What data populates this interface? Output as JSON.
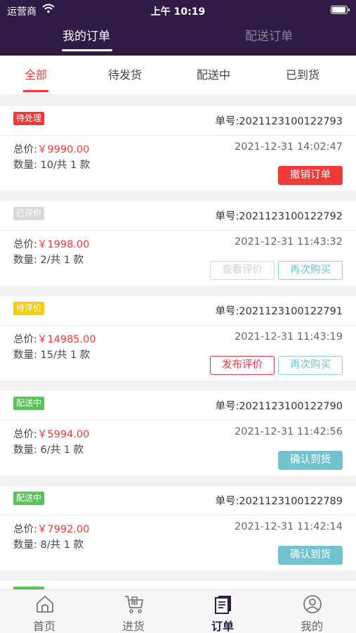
{
  "status_bar": {
    "carrier": "运营商",
    "time": "上午 10:19"
  },
  "top_tabs": [
    {
      "label": "我的订单",
      "active": true
    },
    {
      "label": "配送订单",
      "active": false
    }
  ],
  "sub_tabs": [
    {
      "label": "全部",
      "active": true
    },
    {
      "label": "待发货",
      "active": false
    },
    {
      "label": "配送中",
      "active": false
    },
    {
      "label": "已到货",
      "active": false
    }
  ],
  "orders": [
    {
      "status": "待处理",
      "status_color": "#f03a3a",
      "order_no": "单号:2021123100122793",
      "price_label": "总价:",
      "price": "￥9990.00",
      "date": "2021-12-31 14:02:47",
      "qty": "数量: 10/共 1 款",
      "buttons": [
        "撤销订单"
      ]
    },
    {
      "status": "已评价",
      "status_color": "#d9d9d9",
      "order_no": "单号:2021123100122792",
      "price_label": "总价:",
      "price": "￥1998.00",
      "date": "2021-12-31 11:43:32",
      "qty": "数量: 2/共 1 款",
      "buttons": [
        "查看评价",
        "再次购买"
      ]
    },
    {
      "status": "待评价",
      "status_color": "#f5cd00",
      "order_no": "单号:2021123100122791",
      "price_label": "总价:",
      "price": "￥14985.00",
      "date": "2021-12-31 11:43:19",
      "qty": "数量: 15/共 1 款",
      "buttons": [
        "发布评价",
        "再次购买"
      ]
    },
    {
      "status": "配送中",
      "status_color": "#5cc15a",
      "order_no": "单号:2021123100122790",
      "price_label": "总价:",
      "price": "￥5994.00",
      "date": "2021-12-31 11:42:56",
      "qty": "数量: 6/共 1 款",
      "buttons": [
        "确认到货"
      ]
    },
    {
      "status": "配送中",
      "status_color": "#5cc15a",
      "order_no": "单号:2021123100122789",
      "price_label": "总价:",
      "price": "￥7992.00",
      "date": "2021-12-31 11:42:14",
      "qty": "数量: 8/共 1 款",
      "buttons": [
        "确认到货"
      ]
    }
  ],
  "bottom_tabs": [
    {
      "label": "首页",
      "icon": "home-icon",
      "active": false
    },
    {
      "label": "进货",
      "icon": "cart-icon",
      "active": false
    },
    {
      "label": "订单",
      "icon": "order-icon",
      "active": true
    },
    {
      "label": "我的",
      "icon": "user-icon",
      "active": false
    }
  ],
  "colors": {
    "header_bg": "#2f1b44",
    "accent_red": "#f03a3a",
    "accent_cyan": "#71c3cf"
  }
}
